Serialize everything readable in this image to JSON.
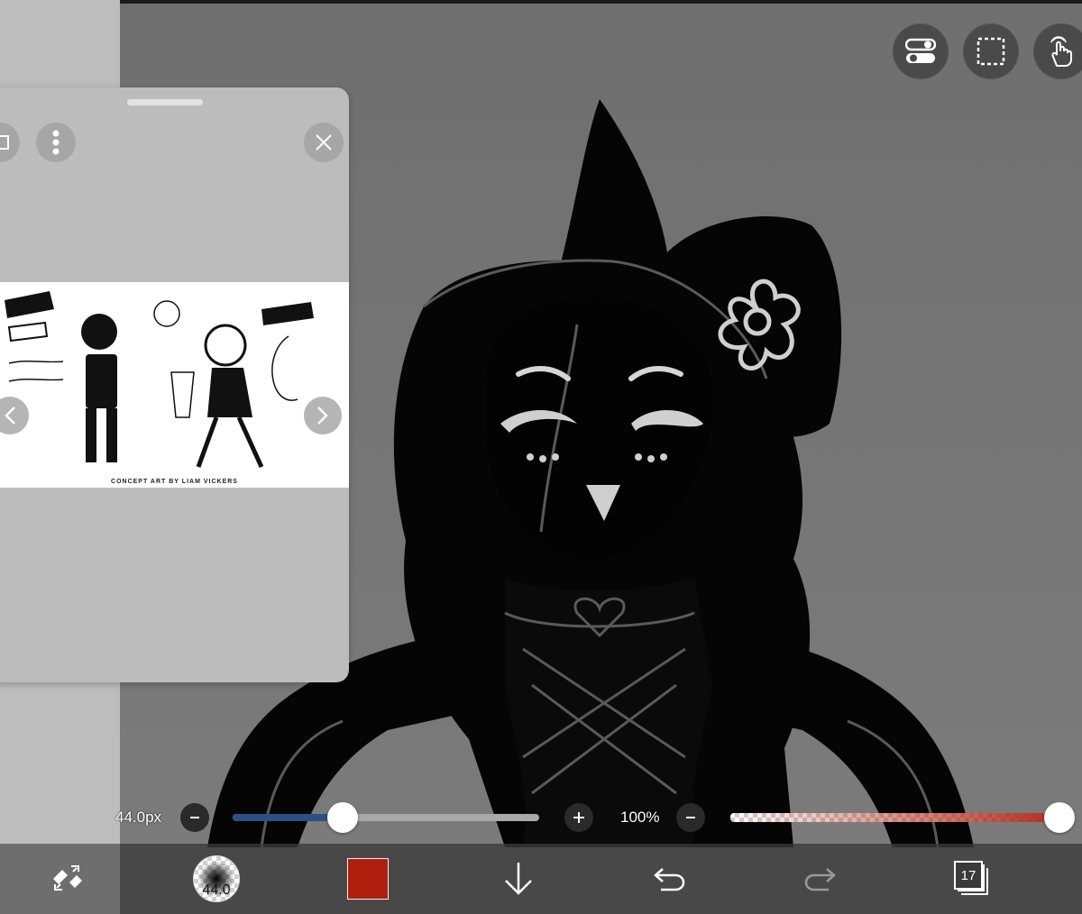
{
  "top_buttons": [
    {
      "name": "toggle-settings-button",
      "icon": "toggle-icon"
    },
    {
      "name": "selection-button",
      "icon": "dashed-selection-icon"
    },
    {
      "name": "touch-gesture-button",
      "icon": "hand-tap-icon"
    }
  ],
  "reference_panel": {
    "caption": "CONCEPT ART BY LIAM VICKERS",
    "icons": {
      "frame": "frame-icon",
      "more": "more-vertical-icon",
      "close": "close-icon",
      "prev": "chevron-left-icon",
      "next": "chevron-right-icon"
    }
  },
  "brush_size_slider": {
    "label": "44.0px",
    "minus_icon": "minus-icon",
    "plus_icon": "plus-icon",
    "value_fraction": 0.36,
    "color": "#2d4f86"
  },
  "opacity_slider": {
    "label": "100%",
    "minus_icon": "minus-icon",
    "value_fraction": 1.0,
    "color": "#b22d1c"
  },
  "toolbar": {
    "transform_icon": "transform-eraser-icon",
    "brush_size": "44.0",
    "color": "#b01f0d",
    "down_icon": "arrow-down-icon",
    "undo_icon": "undo-icon",
    "redo_icon": "redo-icon",
    "layer_count": "17"
  }
}
